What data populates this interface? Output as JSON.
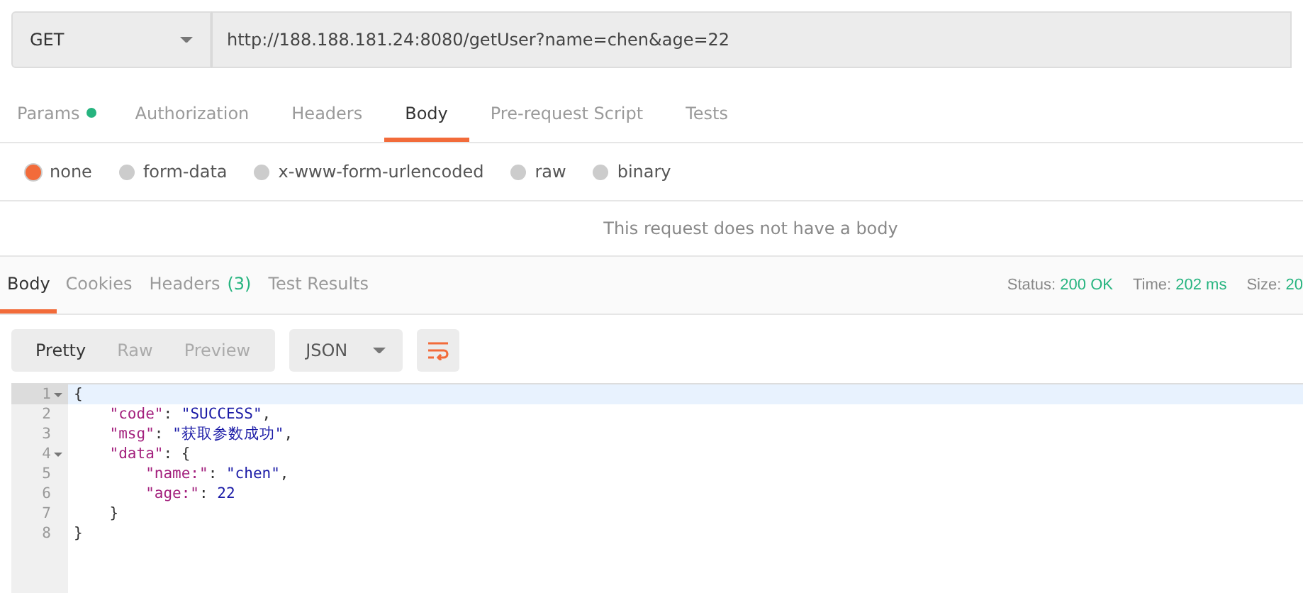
{
  "request": {
    "method": "GET",
    "url": "http://188.188.181.24:8080/getUser?name=chen&age=22"
  },
  "request_tabs": [
    {
      "label": "Params",
      "dot": true,
      "selected": false
    },
    {
      "label": "Authorization",
      "dot": false,
      "selected": false
    },
    {
      "label": "Headers",
      "dot": false,
      "selected": false
    },
    {
      "label": "Body",
      "dot": false,
      "selected": true
    },
    {
      "label": "Pre-request Script",
      "dot": false,
      "selected": false
    },
    {
      "label": "Tests",
      "dot": false,
      "selected": false
    }
  ],
  "body_types": [
    {
      "label": "none",
      "selected": true
    },
    {
      "label": "form-data",
      "selected": false
    },
    {
      "label": "x-www-form-urlencoded",
      "selected": false
    },
    {
      "label": "raw",
      "selected": false
    },
    {
      "label": "binary",
      "selected": false
    }
  ],
  "body_message": "This request does not have a body",
  "response_tabs": [
    {
      "label": "Body",
      "selected": true
    },
    {
      "label": "Cookies",
      "selected": false
    },
    {
      "label": "Headers",
      "count": "(3)",
      "selected": false
    },
    {
      "label": "Test Results",
      "selected": false
    }
  ],
  "response_meta": [
    {
      "label": "Status:",
      "value": "200 OK"
    },
    {
      "label": "Time:",
      "value": "202 ms"
    },
    {
      "label": "Size:",
      "value": "20"
    }
  ],
  "view_modes": [
    {
      "label": "Pretty",
      "selected": true
    },
    {
      "label": "Raw",
      "selected": false
    },
    {
      "label": "Preview",
      "selected": false
    }
  ],
  "format": "JSON",
  "code_lines": [
    {
      "number": "1",
      "foldable": true,
      "active": true,
      "tokens": [
        {
          "kind": "punct",
          "text": "{"
        }
      ]
    },
    {
      "number": "2",
      "foldable": false,
      "active": false,
      "tokens": [
        {
          "kind": "key",
          "text": "    \"code\""
        },
        {
          "kind": "punct",
          "text": ": "
        },
        {
          "kind": "string",
          "text": "\"SUCCESS\""
        },
        {
          "kind": "punct",
          "text": ","
        }
      ]
    },
    {
      "number": "3",
      "foldable": false,
      "active": false,
      "tokens": [
        {
          "kind": "key",
          "text": "    \"msg\""
        },
        {
          "kind": "punct",
          "text": ": "
        },
        {
          "kind": "string",
          "text": "\"获取参数成功\""
        },
        {
          "kind": "punct",
          "text": ","
        }
      ]
    },
    {
      "number": "4",
      "foldable": true,
      "active": false,
      "tokens": [
        {
          "kind": "key",
          "text": "    \"data\""
        },
        {
          "kind": "punct",
          "text": ": {"
        }
      ]
    },
    {
      "number": "5",
      "foldable": false,
      "active": false,
      "tokens": [
        {
          "kind": "key",
          "text": "        \"name:\""
        },
        {
          "kind": "punct",
          "text": ": "
        },
        {
          "kind": "string",
          "text": "\"chen\""
        },
        {
          "kind": "punct",
          "text": ","
        }
      ]
    },
    {
      "number": "6",
      "foldable": false,
      "active": false,
      "tokens": [
        {
          "kind": "key",
          "text": "        \"age:\""
        },
        {
          "kind": "punct",
          "text": ": "
        },
        {
          "kind": "number",
          "text": "22"
        }
      ]
    },
    {
      "number": "7",
      "foldable": false,
      "active": false,
      "tokens": [
        {
          "kind": "punct",
          "text": "    }"
        }
      ]
    },
    {
      "number": "8",
      "foldable": false,
      "active": false,
      "tokens": [
        {
          "kind": "punct",
          "text": "}"
        }
      ]
    }
  ]
}
